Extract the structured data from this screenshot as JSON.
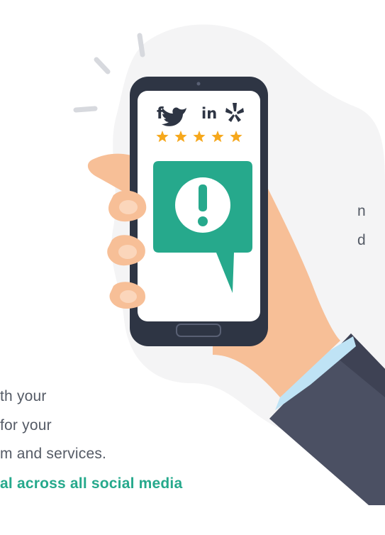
{
  "text_fragments": [
    "n",
    "d",
    "th your",
    "for your",
    "m and services."
  ],
  "highlight_text": "al across all social media",
  "phone": {
    "social_icons": [
      "facebook-icon",
      "twitter-icon",
      "linkedin-icon",
      "yelp-icon"
    ],
    "facebook_glyph": "f",
    "linkedin_glyph": "in",
    "rating": {
      "value": 5,
      "max": 5
    },
    "alert_glyph": "!"
  },
  "colors": {
    "text": "#555b66",
    "accent": "#26a98c",
    "star": "#f6a81c",
    "phone_body": "#2e3544",
    "skin": "#f7bf97",
    "sleeve": "#4b5063",
    "cuff": "#bfe3f5",
    "blob": "#f4f4f5"
  }
}
